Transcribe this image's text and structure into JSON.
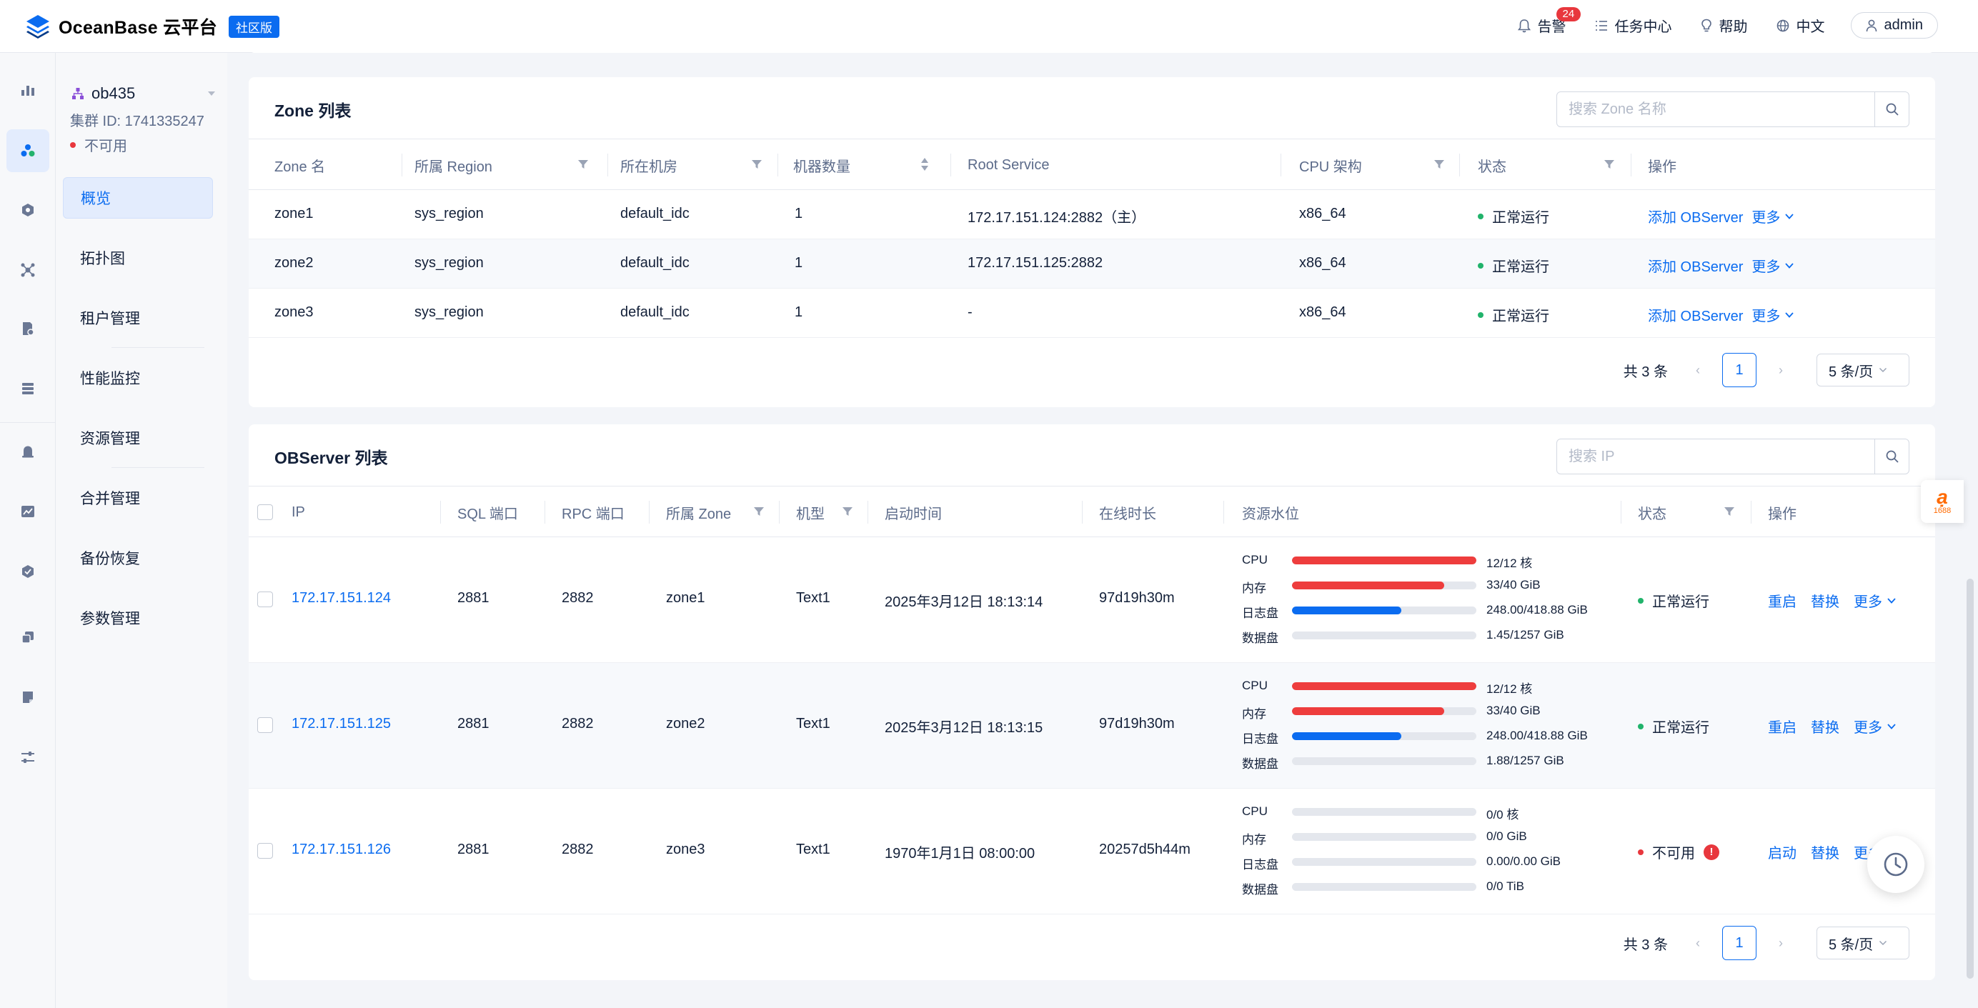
{
  "header": {
    "brand": "OceanBase 云平台",
    "edition_badge": "社区版",
    "alarm_label": "告警",
    "alarm_count": "24",
    "tasks_label": "任务中心",
    "help_label": "帮助",
    "language_label": "中文",
    "user_label": "admin"
  },
  "cluster": {
    "name": "ob435",
    "id_text": "集群 ID: 1741335247",
    "status": "不可用"
  },
  "nav": {
    "items": [
      {
        "label": "概览"
      },
      {
        "label": "拓扑图"
      },
      {
        "label": "租户管理"
      },
      {
        "label": "性能监控"
      },
      {
        "label": "资源管理"
      },
      {
        "label": "合并管理"
      },
      {
        "label": "备份恢复"
      },
      {
        "label": "参数管理"
      }
    ]
  },
  "zone_table": {
    "title": "Zone 列表",
    "search_placeholder": "搜索 Zone 名称",
    "columns": [
      "Zone 名",
      "所属 Region",
      "所在机房",
      "机器数量",
      "Root Service",
      "CPU 架构",
      "状态",
      "操作"
    ],
    "rows": [
      {
        "zone": "zone1",
        "region": "sys_region",
        "idc": "default_idc",
        "count": "1",
        "root_service": "172.17.151.124:2882（主）",
        "arch": "x86_64",
        "status": "正常运行",
        "action1": "添加 OBServer",
        "action2": "更多"
      },
      {
        "zone": "zone2",
        "region": "sys_region",
        "idc": "default_idc",
        "count": "1",
        "root_service": "172.17.151.125:2882",
        "arch": "x86_64",
        "status": "正常运行",
        "action1": "添加 OBServer",
        "action2": "更多"
      },
      {
        "zone": "zone3",
        "region": "sys_region",
        "idc": "default_idc",
        "count": "1",
        "root_service": "-",
        "arch": "x86_64",
        "status": "正常运行",
        "action1": "添加 OBServer",
        "action2": "更多"
      }
    ],
    "pager": {
      "total": "共 3 条",
      "page": "1",
      "page_size": "5 条/页"
    }
  },
  "observer_table": {
    "title": "OBServer 列表",
    "search_placeholder": "搜索 IP",
    "columns": [
      "IP",
      "SQL 端口",
      "RPC 端口",
      "所属 Zone",
      "机型",
      "启动时间",
      "在线时长",
      "资源水位",
      "状态",
      "操作"
    ],
    "resource_labels": [
      "CPU",
      "内存",
      "日志盘",
      "数据盘"
    ],
    "rows": [
      {
        "ip": "172.17.151.124",
        "sql_port": "2881",
        "rpc_port": "2882",
        "zone": "zone1",
        "model": "Text1",
        "start_time": "2025年3月12日 18:13:14",
        "uptime": "97d19h30m",
        "resources": [
          {
            "value": "12/12 核",
            "level": 1.0,
            "color": "#ee3d3d"
          },
          {
            "value": "33/40 GiB",
            "level": 0.825,
            "color": "#ee3d3d"
          },
          {
            "value": "248.00/418.88 GiB",
            "level": 0.592,
            "color": "#0b6cf0"
          },
          {
            "value": "1.45/1257 GiB",
            "level": 0.0,
            "color": "#0b6cf0"
          }
        ],
        "status": "正常运行",
        "status_color": "green",
        "actions": [
          "重启",
          "替换",
          "更多"
        ]
      },
      {
        "ip": "172.17.151.125",
        "sql_port": "2881",
        "rpc_port": "2882",
        "zone": "zone2",
        "model": "Text1",
        "start_time": "2025年3月12日 18:13:15",
        "uptime": "97d19h30m",
        "resources": [
          {
            "value": "12/12 核",
            "level": 1.0,
            "color": "#ee3d3d"
          },
          {
            "value": "33/40 GiB",
            "level": 0.825,
            "color": "#ee3d3d"
          },
          {
            "value": "248.00/418.88 GiB",
            "level": 0.592,
            "color": "#0b6cf0"
          },
          {
            "value": "1.88/1257 GiB",
            "level": 0.0,
            "color": "#0b6cf0"
          }
        ],
        "status": "正常运行",
        "status_color": "green",
        "actions": [
          "重启",
          "替换",
          "更多"
        ]
      },
      {
        "ip": "172.17.151.126",
        "sql_port": "2881",
        "rpc_port": "2882",
        "zone": "zone3",
        "model": "Text1",
        "start_time": "1970年1月1日 08:00:00",
        "uptime": "20257d5h44m",
        "resources": [
          {
            "value": "0/0 核",
            "level": 0.0,
            "color": "#0b6cf0"
          },
          {
            "value": "0/0 GiB",
            "level": 0.0,
            "color": "#0b6cf0"
          },
          {
            "value": "0.00/0.00 GiB",
            "level": 0.0,
            "color": "#0b6cf0"
          },
          {
            "value": "0/0 TiB",
            "level": 0.0,
            "color": "#0b6cf0"
          }
        ],
        "status": "不可用",
        "status_color": "red",
        "actions": [
          "启动",
          "替换",
          "更多"
        ]
      }
    ],
    "pager": {
      "total": "共 3 条",
      "page": "1",
      "page_size": "5 条/页"
    }
  },
  "float_badge": {
    "logo_text": "1688"
  },
  "colors": {
    "primary": "#0b6cf0",
    "success": "#21b36b",
    "danger": "#e8373d"
  }
}
